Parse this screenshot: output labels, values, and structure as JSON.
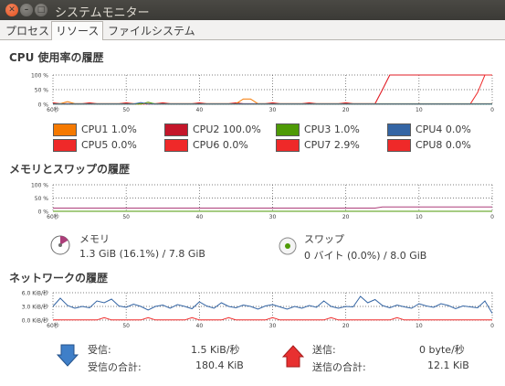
{
  "window": {
    "title": "システムモニター"
  },
  "tabs": [
    {
      "label": "プロセス"
    },
    {
      "label": "リソース"
    },
    {
      "label": "ファイルシステム"
    }
  ],
  "cpu": {
    "title": "CPU 使用率の履歴",
    "yticks": [
      "100 %",
      "50 %",
      "0 %"
    ],
    "xticks": [
      "60秒",
      "50",
      "40",
      "30",
      "20",
      "10",
      "0"
    ],
    "cores": [
      {
        "label": "CPU1",
        "value": "1.0%",
        "color": "#f57900"
      },
      {
        "label": "CPU2",
        "value": "100.0%",
        "color": "#c4162a"
      },
      {
        "label": "CPU3",
        "value": "1.0%",
        "color": "#4e9a06"
      },
      {
        "label": "CPU4",
        "value": "0.0%",
        "color": "#3465a4"
      },
      {
        "label": "CPU5",
        "value": "0.0%",
        "color": "#ef2929"
      },
      {
        "label": "CPU6",
        "value": "0.0%",
        "color": "#ef2929"
      },
      {
        "label": "CPU7",
        "value": "2.9%",
        "color": "#ef2929"
      },
      {
        "label": "CPU8",
        "value": "0.0%",
        "color": "#ef2929"
      }
    ]
  },
  "memory": {
    "title": "メモリとスワップの履歴",
    "yticks": [
      "100 %",
      "50 %",
      "0 %"
    ],
    "xticks": [
      "60秒",
      "50",
      "40",
      "30",
      "20",
      "10",
      "0"
    ],
    "mem_label": "メモリ",
    "mem_value": "1.3 GiB (16.1%) / 7.8 GiB",
    "mem_fraction": 0.161,
    "swap_label": "スワップ",
    "swap_value": "0 バイト (0.0%) / 8.0 GiB",
    "swap_fraction": 0.0
  },
  "network": {
    "title": "ネットワークの履歴",
    "yticks": [
      "6.0 KiB/秒",
      "3.0 KiB/秒",
      "0.0 KiB/秒"
    ],
    "xticks": [
      "60秒",
      "50",
      "40",
      "30",
      "20",
      "10",
      "0"
    ],
    "recv_label": "受信:",
    "recv_value": "1.5 KiB/秒",
    "recv_total_label": "受信の合計:",
    "recv_total_value": "180.4 KiB",
    "send_label": "送信:",
    "send_value": "0 byte/秒",
    "send_total_label": "送信の合計:",
    "send_total_value": "12.1 KiB"
  },
  "colors": {
    "recv": "#3465a4",
    "send": "#ef2929",
    "memory": "#ad3e7a",
    "swap": "#4e9a06"
  }
}
